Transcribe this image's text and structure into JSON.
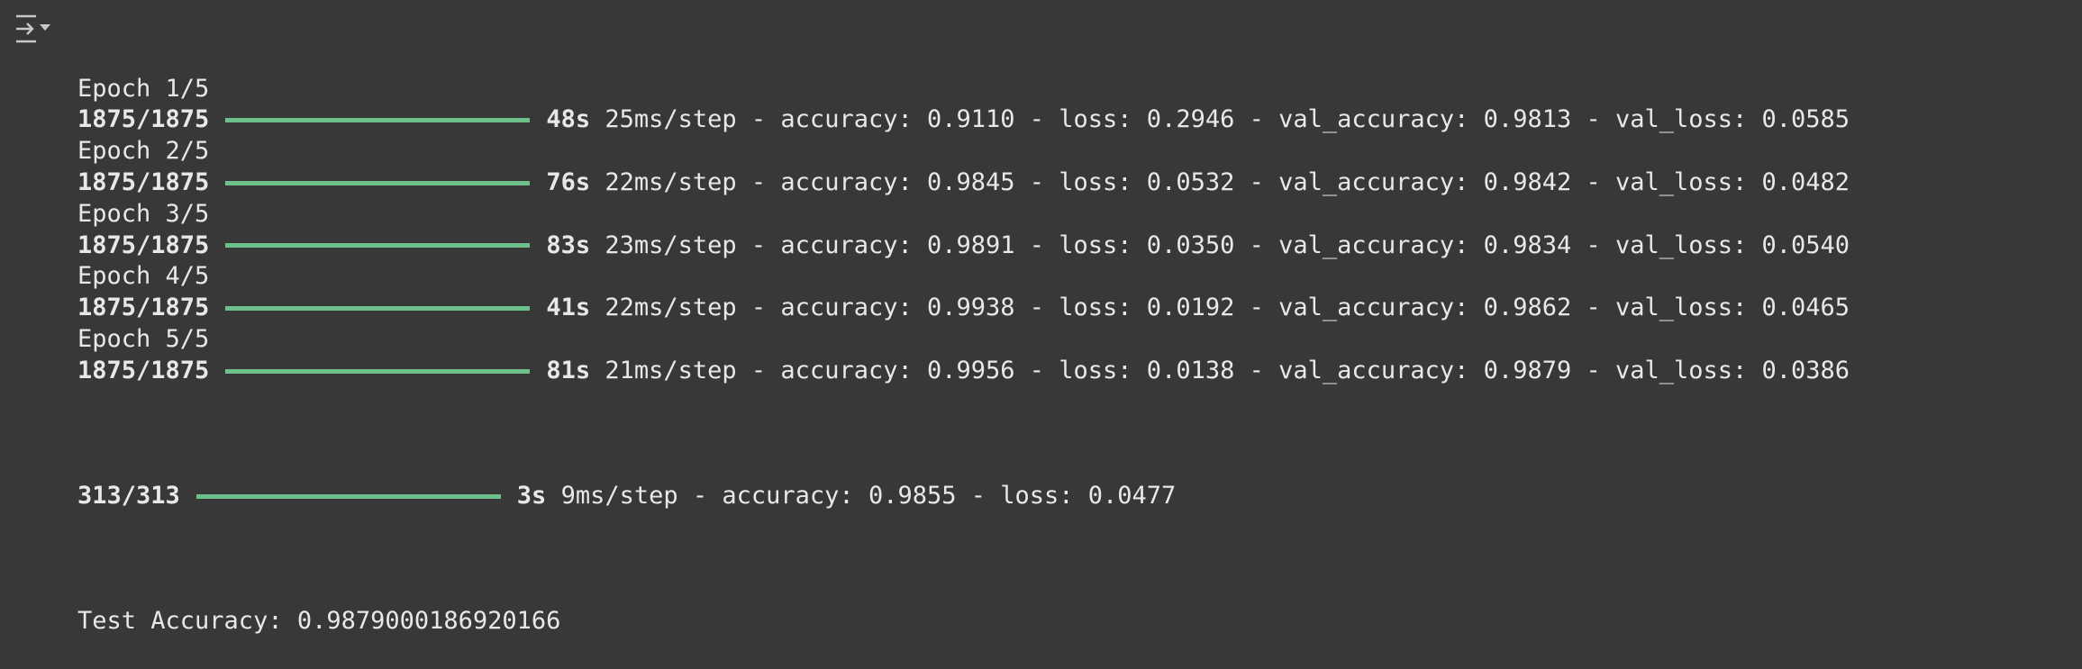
{
  "icon": "output-collapse-icon",
  "colors": {
    "background": "#383838",
    "text": "#e8e8e8",
    "progress": "#6dbf8b"
  },
  "epochs": [
    {
      "label": "Epoch 1/5",
      "steps": "1875/1875",
      "progress": 1.0,
      "time": "48s",
      "rest": "25ms/step - accuracy: 0.9110 - loss: 0.2946 - val_accuracy: 0.9813 - val_loss: 0.0585"
    },
    {
      "label": "Epoch 2/5",
      "steps": "1875/1875",
      "progress": 1.0,
      "time": "76s",
      "rest": "22ms/step - accuracy: 0.9845 - loss: 0.0532 - val_accuracy: 0.9842 - val_loss: 0.0482"
    },
    {
      "label": "Epoch 3/5",
      "steps": "1875/1875",
      "progress": 1.0,
      "time": "83s",
      "rest": "23ms/step - accuracy: 0.9891 - loss: 0.0350 - val_accuracy: 0.9834 - val_loss: 0.0540"
    },
    {
      "label": "Epoch 4/5",
      "steps": "1875/1875",
      "progress": 1.0,
      "time": "41s",
      "rest": "22ms/step - accuracy: 0.9938 - loss: 0.0192 - val_accuracy: 0.9862 - val_loss: 0.0465"
    },
    {
      "label": "Epoch 5/5",
      "steps": "1875/1875",
      "progress": 1.0,
      "time": "81s",
      "rest": "21ms/step - accuracy: 0.9956 - loss: 0.0138 - val_accuracy: 0.9879 - val_loss: 0.0386"
    }
  ],
  "evaluation": {
    "steps": "313/313",
    "progress": 1.0,
    "time": "3s",
    "rest": "9ms/step - accuracy: 0.9855 - loss: 0.0477"
  },
  "test_accuracy": "Test Accuracy: 0.9879000186920166"
}
